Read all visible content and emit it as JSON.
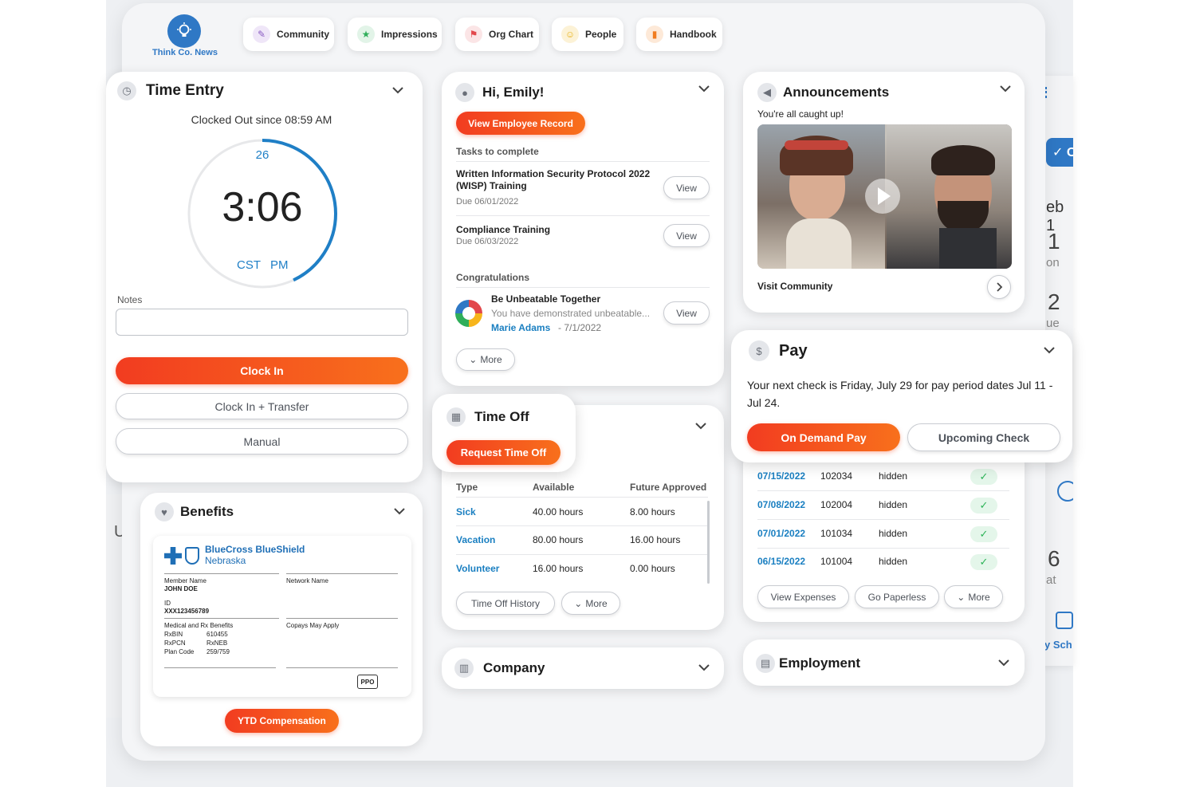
{
  "brand": {
    "name": "Think Co. News",
    "color": "#2f78c5"
  },
  "nav": [
    {
      "label": "Community",
      "icon": "community-icon",
      "color": "#8a5cc2"
    },
    {
      "label": "Impressions",
      "icon": "star-icon",
      "color": "#2fae5a"
    },
    {
      "label": "Org Chart",
      "icon": "org-chart-icon",
      "color": "#e2474b"
    },
    {
      "label": "People",
      "icon": "people-icon",
      "color": "#e8b21c"
    },
    {
      "label": "Handbook",
      "icon": "handbook-icon",
      "color": "#f07b1e"
    }
  ],
  "time_entry": {
    "title": "Time Entry",
    "status": "Clocked Out since 08:59 AM",
    "clock": {
      "seconds": "26",
      "time": "3:06",
      "tz": "CST",
      "ampm": "PM",
      "progress": 0.43
    },
    "notes_label": "Notes",
    "notes_value": "",
    "clock_in": "Clock In",
    "clock_in_transfer": "Clock In + Transfer",
    "manual": "Manual"
  },
  "benefits": {
    "title": "Benefits",
    "card": {
      "provider_line1": "BlueCross BlueShield",
      "provider_line2": "Nebraska",
      "member_name_label": "Member Name",
      "member_name": "JOHN DOE",
      "network_label": "Network Name",
      "id_label": "ID",
      "id_value": "XXX123456789",
      "rx_label": "Medical and Rx Benefits",
      "rxbin_label": "RxBIN",
      "rxbin": "610455",
      "rxpcn_label": "RxPCN",
      "rxpcn": "RxNEB",
      "plan_label": "Plan Code",
      "plan": "259/759",
      "copays": "Copays May Apply",
      "ppo": "PPO"
    },
    "ytd_button": "YTD Compensation"
  },
  "greeting": {
    "title": "Hi, Emily!",
    "record_button": "View Employee Record",
    "tasks_heading": "Tasks to complete",
    "tasks": [
      {
        "name": "Written Information Security Protocol 2022 (WISP) Training",
        "due": "Due 06/01/2022",
        "action": "View"
      },
      {
        "name": "Compliance Training",
        "due": "Due 06/03/2022",
        "action": "View"
      }
    ],
    "congrats_heading": "Congratulations",
    "congrats": {
      "title": "Be Unbeatable Together",
      "text": "You have demonstrated unbeatable...",
      "author": "Marie Adams",
      "date": "- 7/1/2022",
      "action": "View"
    },
    "more": "More"
  },
  "time_off": {
    "title": "Time Off",
    "request_button": "Request Time Off",
    "columns": [
      "Type",
      "Available",
      "Future Approved"
    ],
    "rows": [
      {
        "type": "Sick",
        "available": "40.00 hours",
        "future": "8.00 hours"
      },
      {
        "type": "Vacation",
        "available": "80.00 hours",
        "future": "16.00 hours"
      },
      {
        "type": "Volunteer",
        "available": "16.00 hours",
        "future": "0.00 hours"
      }
    ],
    "history_button": "Time Off History",
    "more": "More"
  },
  "company": {
    "title": "Company"
  },
  "announcements": {
    "title": "Announcements",
    "status": "You're all caught up!",
    "link": "Visit Community"
  },
  "pay": {
    "title": "Pay",
    "message": "Your next check is Friday, July 29 for pay period dates Jul 11 - Jul 24.",
    "on_demand": "On Demand Pay",
    "upcoming": "Upcoming Check",
    "checks": [
      {
        "date": "07/15/2022",
        "number": "102034",
        "amount": "hidden"
      },
      {
        "date": "07/08/2022",
        "number": "102004",
        "amount": "hidden"
      },
      {
        "date": "07/01/2022",
        "number": "101034",
        "amount": "hidden"
      },
      {
        "date": "06/15/2022",
        "number": "101004",
        "amount": "hidden"
      }
    ],
    "view_expenses": "View Expenses",
    "go_paperless": "Go Paperless",
    "more": "More"
  },
  "employment": {
    "title": "Employment"
  },
  "background": {
    "right": [
      "O",
      "eb 1",
      "1",
      "on",
      "2",
      "ue",
      "6",
      "at",
      "y Sch"
    ],
    "left": [
      "U"
    ]
  },
  "colors": {
    "accent_orange": "#f4511e",
    "link_blue": "#1a7fc1",
    "success_green": "#2cb357"
  }
}
